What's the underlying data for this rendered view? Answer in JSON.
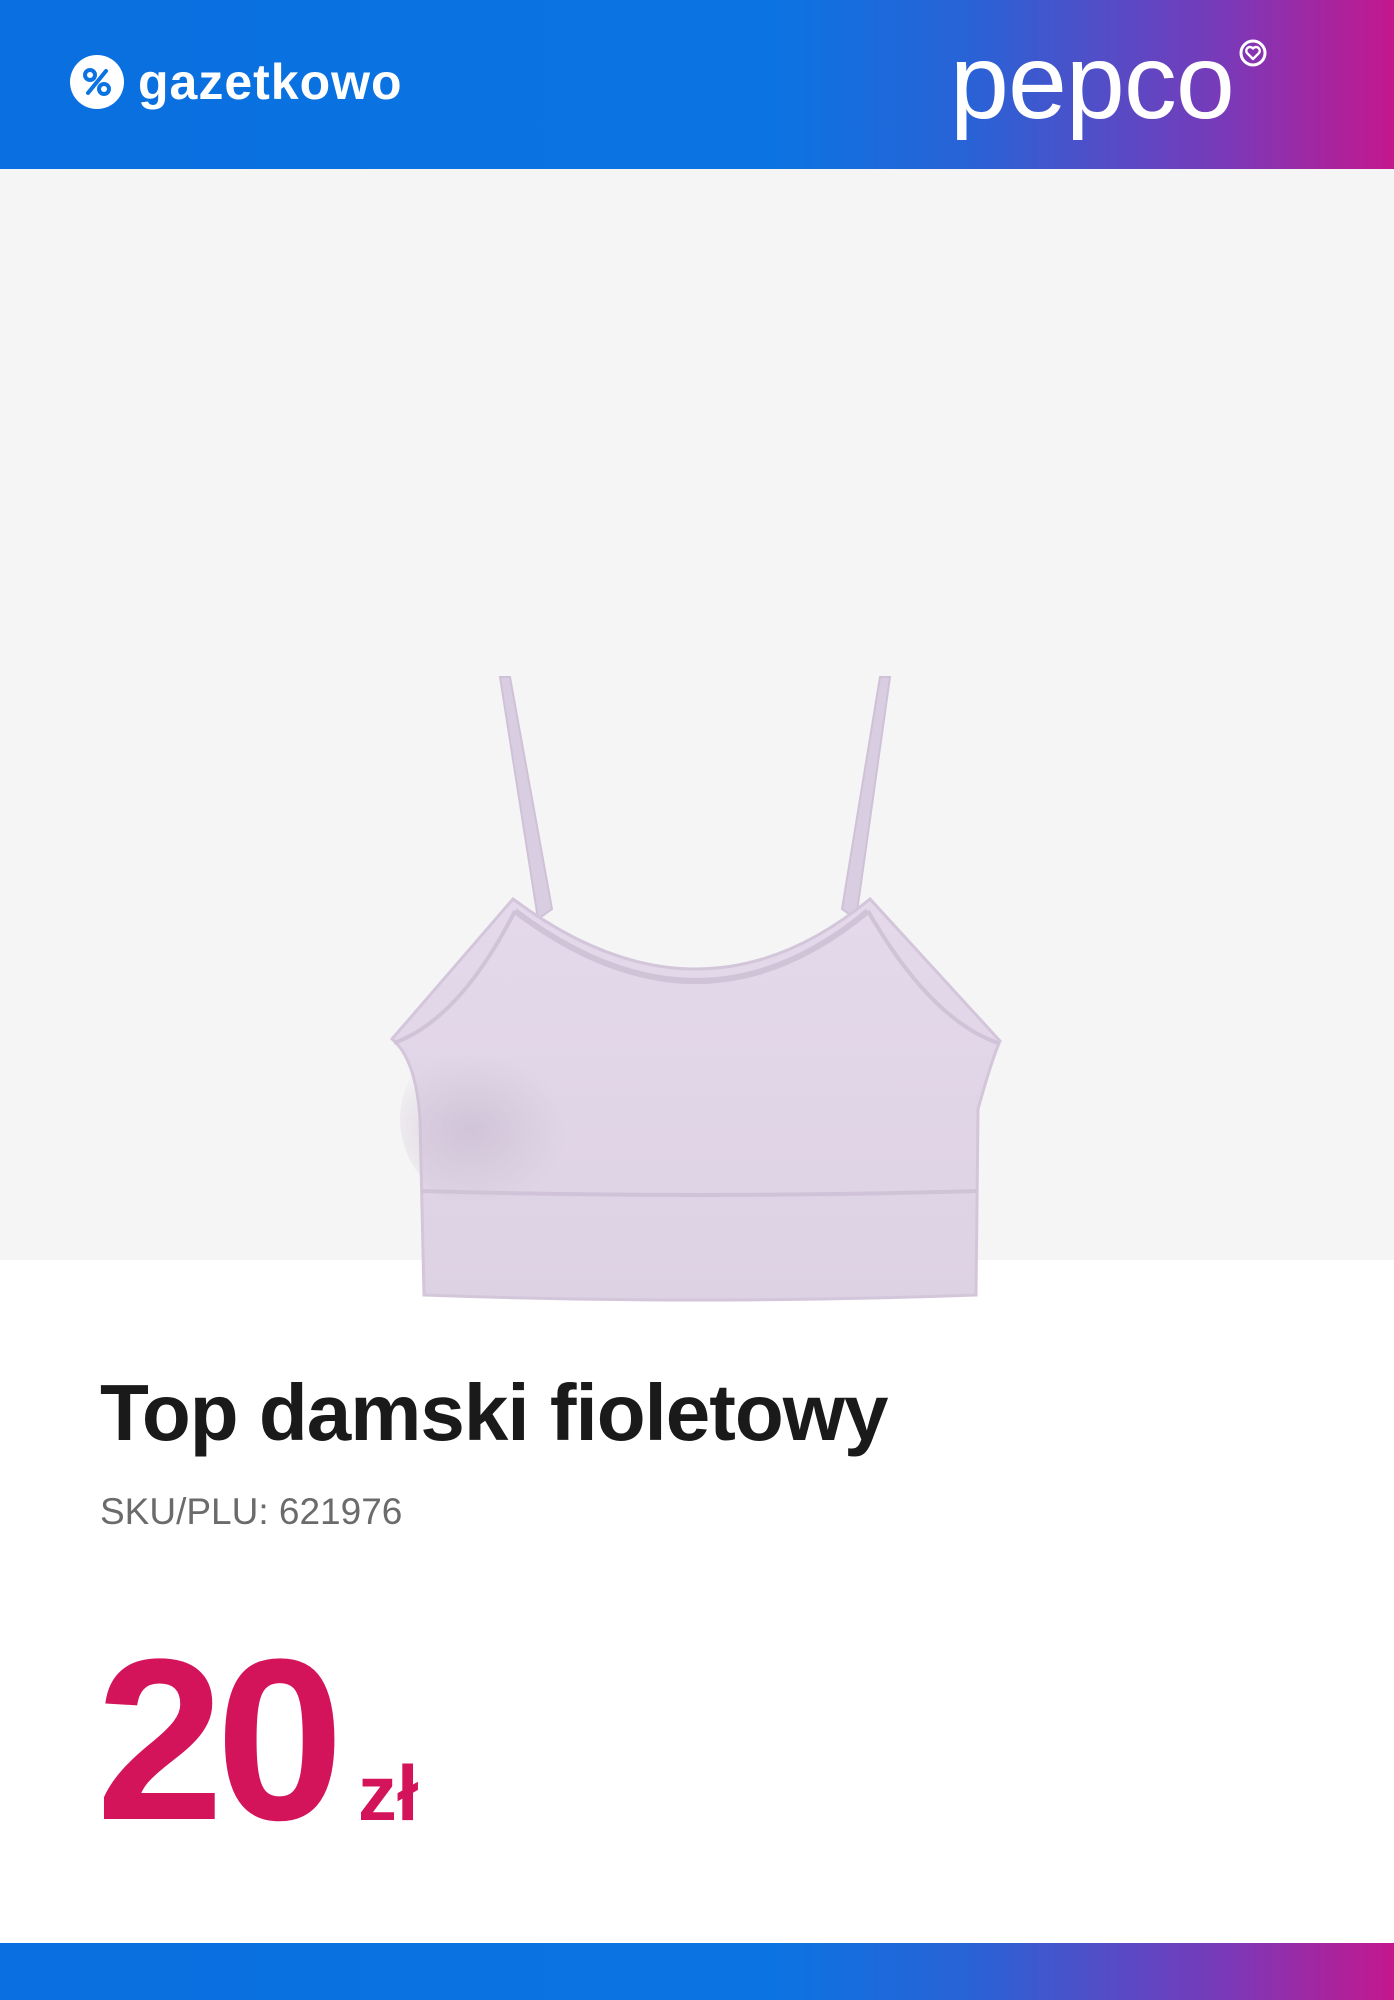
{
  "header": {
    "gazetkowo_logo_text": "gazetkowo",
    "pepco_logo_text": "pepco",
    "gradient_colors": [
      "#0a6fe0",
      "#0b74e2",
      "#7a39b8",
      "#c4178e"
    ]
  },
  "product": {
    "image_icon": "crop-top-bra-lilac",
    "title": "Top damski fioletowy",
    "sku": "SKU/PLU: 621976",
    "price": {
      "amount": "20",
      "currency": "zł",
      "color": "#d4145a"
    }
  }
}
